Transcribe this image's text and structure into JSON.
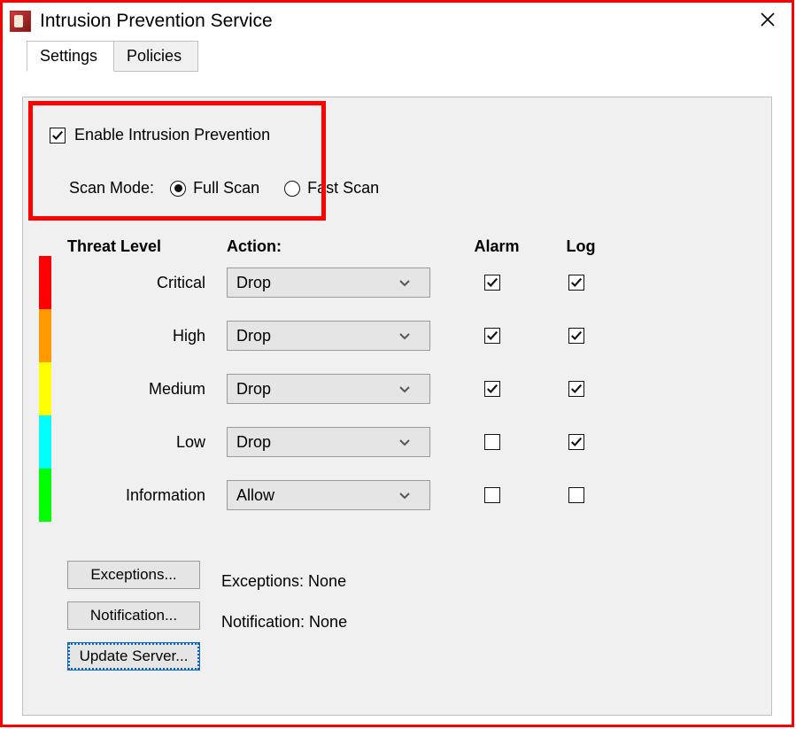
{
  "window": {
    "title": "Intrusion Prevention Service",
    "close": "✕"
  },
  "tabs": [
    {
      "label": "Settings",
      "active": true
    },
    {
      "label": "Policies",
      "active": false
    }
  ],
  "enable": {
    "label": "Enable Intrusion Prevention",
    "checked": true
  },
  "scan_mode": {
    "label": "Scan Mode:",
    "options": [
      {
        "label": "Full Scan",
        "selected": true
      },
      {
        "label": "Fast Scan",
        "selected": false
      }
    ]
  },
  "headers": {
    "threat": "Threat Level",
    "action": "Action:",
    "alarm": "Alarm",
    "log": "Log"
  },
  "levels": [
    {
      "name": "Critical",
      "color": "#ff0000",
      "action": "Drop",
      "alarm": true,
      "log": true
    },
    {
      "name": "High",
      "color": "#ff9900",
      "action": "Drop",
      "alarm": true,
      "log": true
    },
    {
      "name": "Medium",
      "color": "#ffff00",
      "action": "Drop",
      "alarm": true,
      "log": true
    },
    {
      "name": "Low",
      "color": "#00ffff",
      "action": "Drop",
      "alarm": false,
      "log": true
    },
    {
      "name": "Information",
      "color": "#00ff00",
      "action": "Allow",
      "alarm": false,
      "log": false
    }
  ],
  "buttons": {
    "exceptions": "Exceptions...",
    "notification": "Notification...",
    "update_server": "Update Server..."
  },
  "status": {
    "exceptions": "Exceptions: None",
    "notification": "Notification: None"
  }
}
